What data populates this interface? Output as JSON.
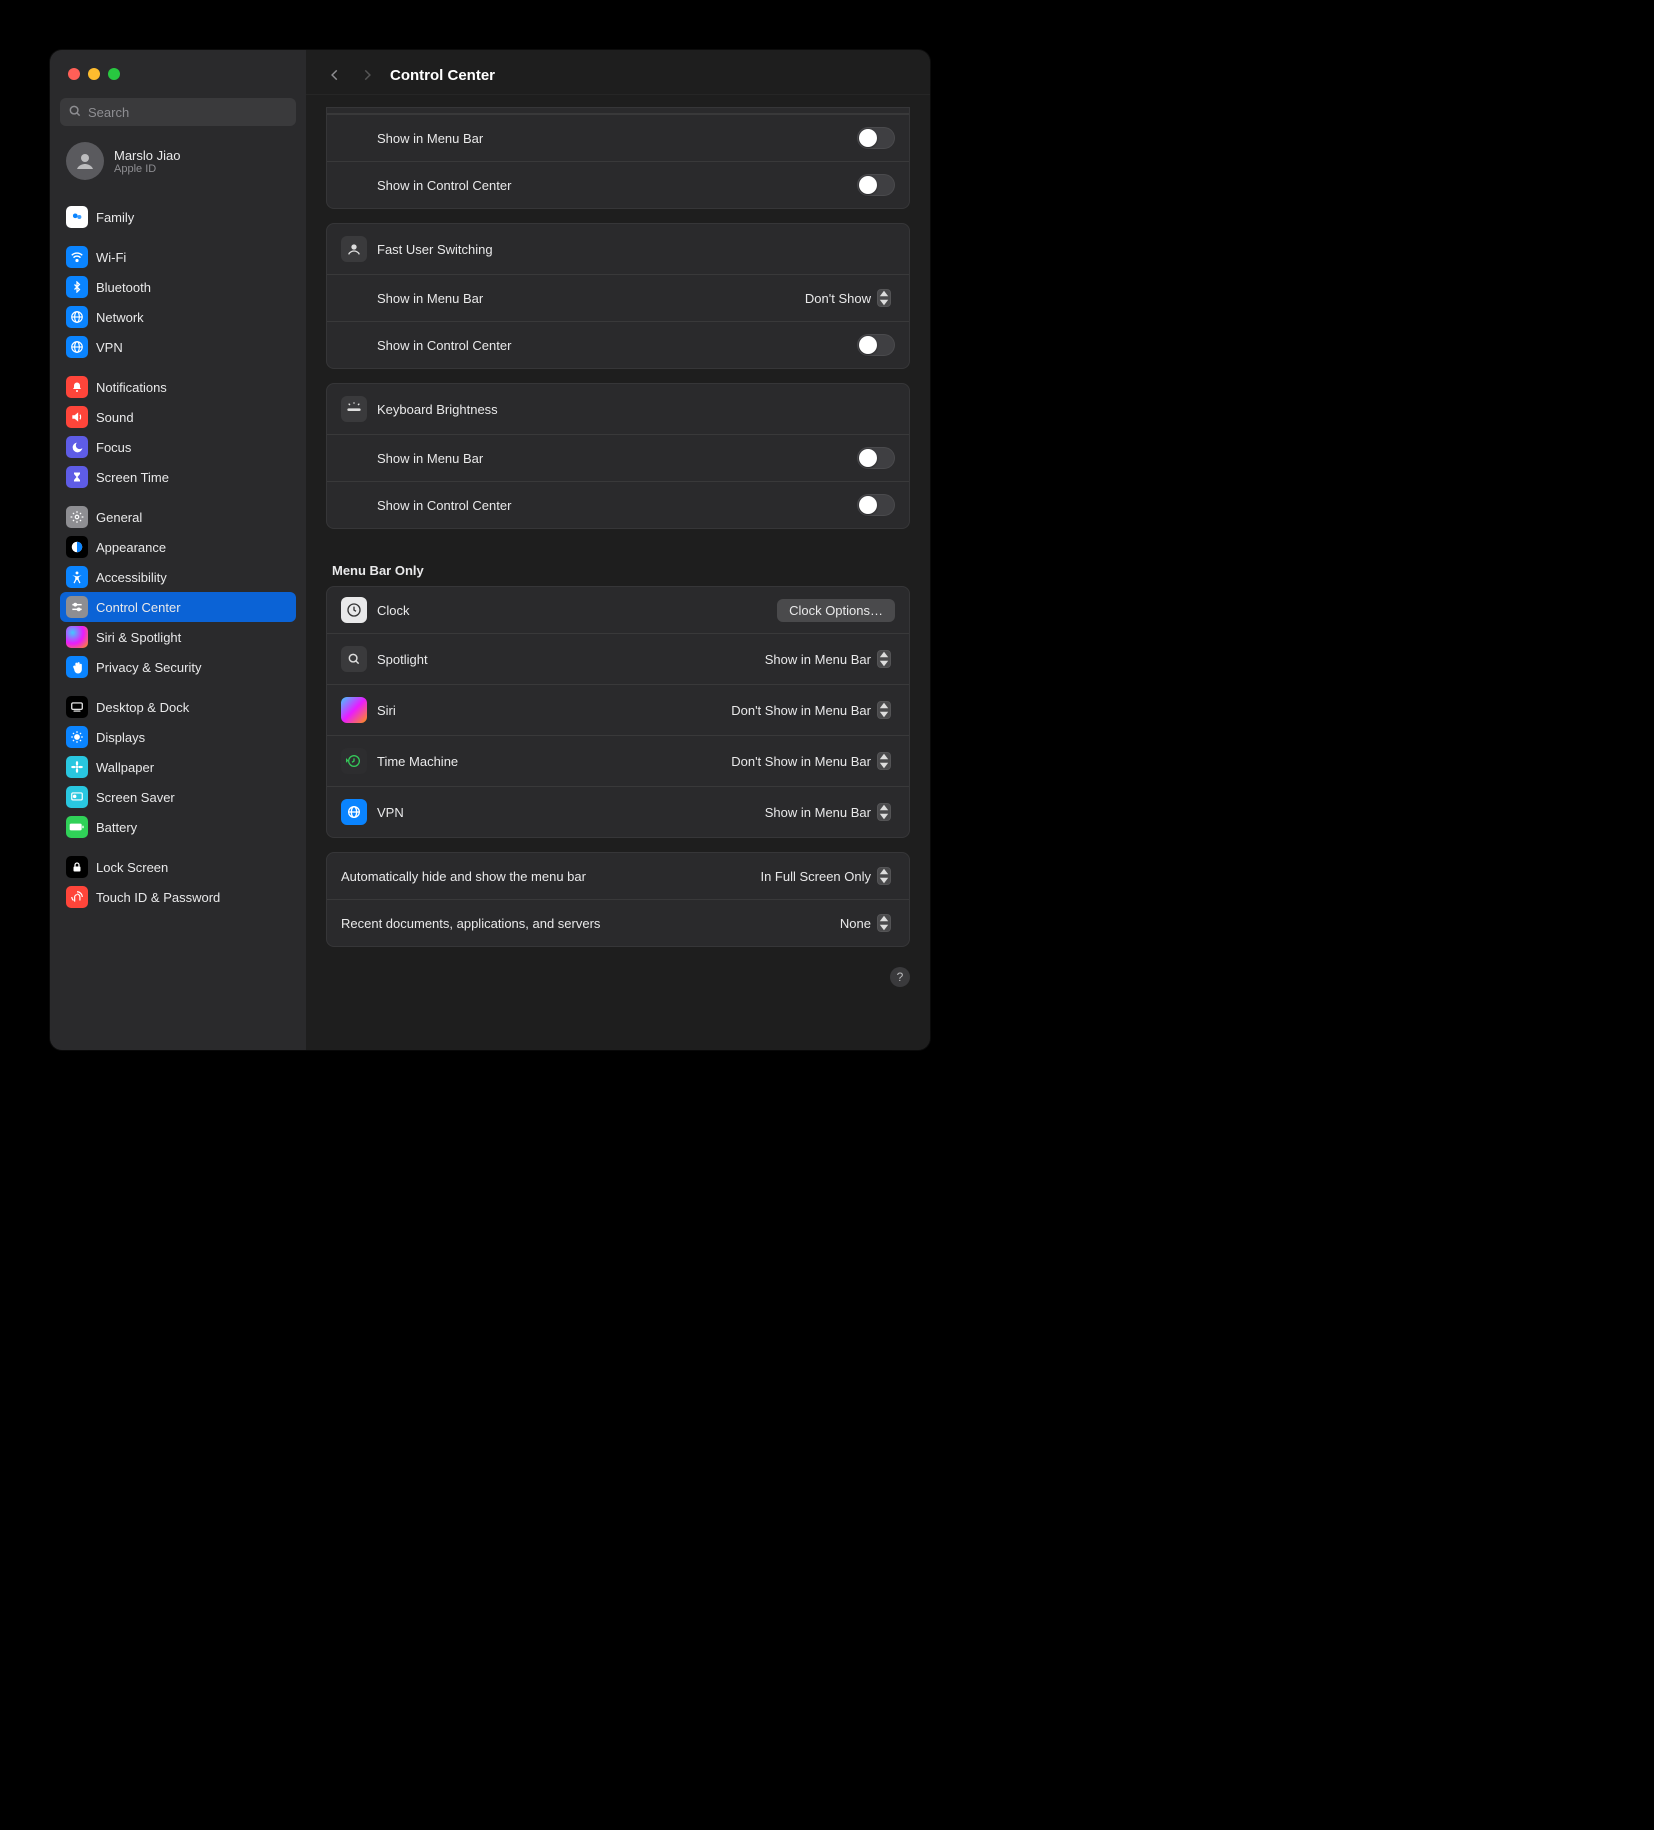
{
  "search": {
    "placeholder": "Search"
  },
  "account": {
    "name": "Marslo Jiao",
    "sub": "Apple ID"
  },
  "sidebar": {
    "items": [
      {
        "label": "Family",
        "icon": "tv-icon",
        "bg": "#ffffff",
        "fg": "#0a84ff"
      },
      {
        "label": "Wi-Fi",
        "icon": "wifi-icon",
        "bg": "#0a84ff"
      },
      {
        "label": "Bluetooth",
        "icon": "bluetooth-icon",
        "bg": "#0a84ff"
      },
      {
        "label": "Network",
        "icon": "globe-icon",
        "bg": "#0a84ff"
      },
      {
        "label": "VPN",
        "icon": "vpn-icon",
        "bg": "#0a84ff"
      },
      {
        "label": "Notifications",
        "icon": "bell-icon",
        "bg": "#ff453a"
      },
      {
        "label": "Sound",
        "icon": "sound-icon",
        "bg": "#ff453a"
      },
      {
        "label": "Focus",
        "icon": "moon-icon",
        "bg": "#5e5ce6"
      },
      {
        "label": "Screen Time",
        "icon": "hourglass-icon",
        "bg": "#5e5ce6"
      },
      {
        "label": "General",
        "icon": "gear-icon",
        "bg": "#8e8e92"
      },
      {
        "label": "Appearance",
        "icon": "appearance-icon",
        "bg": "#000000"
      },
      {
        "label": "Accessibility",
        "icon": "accessibility-icon",
        "bg": "#0a84ff"
      },
      {
        "label": "Control Center",
        "icon": "sliders-icon",
        "bg": "#8e8e92",
        "selected": true
      },
      {
        "label": "Siri & Spotlight",
        "icon": "siri-icon",
        "bg": "#111111"
      },
      {
        "label": "Privacy & Security",
        "icon": "hand-icon",
        "bg": "#0a84ff"
      },
      {
        "label": "Desktop & Dock",
        "icon": "dock-icon",
        "bg": "#000000"
      },
      {
        "label": "Displays",
        "icon": "brightness-icon",
        "bg": "#0a84ff"
      },
      {
        "label": "Wallpaper",
        "icon": "flower-icon",
        "bg": "#29c7e0"
      },
      {
        "label": "Screen Saver",
        "icon": "screensaver-icon",
        "bg": "#29c7e0"
      },
      {
        "label": "Battery",
        "icon": "battery-icon",
        "bg": "#30d158"
      },
      {
        "label": "Lock Screen",
        "icon": "lock-icon",
        "bg": "#000000"
      },
      {
        "label": "Touch ID & Password",
        "icon": "fingerprint-icon",
        "bg": "#ff453a"
      }
    ]
  },
  "header": {
    "title": "Control Center"
  },
  "top_card": {
    "rows": [
      {
        "label": "Show in Menu Bar",
        "toggle": false
      },
      {
        "label": "Show in Control Center",
        "toggle": false
      }
    ]
  },
  "fus": {
    "title": "Fast User Switching",
    "menu": {
      "label": "Show in Menu Bar",
      "value": "Don't Show"
    },
    "cc": {
      "label": "Show in Control Center",
      "toggle": false
    }
  },
  "kbd": {
    "title": "Keyboard Brightness",
    "rows": [
      {
        "label": "Show in Menu Bar",
        "toggle": false
      },
      {
        "label": "Show in Control Center",
        "toggle": false
      }
    ]
  },
  "section_menu_only": "Menu Bar Only",
  "menu_only": {
    "clock": {
      "label": "Clock",
      "button": "Clock Options…"
    },
    "spotlight": {
      "label": "Spotlight",
      "value": "Show in Menu Bar"
    },
    "siri": {
      "label": "Siri",
      "value": "Don't Show in Menu Bar"
    },
    "tm": {
      "label": "Time Machine",
      "value": "Don't Show in Menu Bar"
    },
    "vpn": {
      "label": "VPN",
      "value": "Show in Menu Bar"
    }
  },
  "bottom": {
    "autohide": {
      "label": "Automatically hide and show the menu bar",
      "value": "In Full Screen Only"
    },
    "recents": {
      "label": "Recent documents, applications, and servers",
      "value": "None"
    }
  }
}
